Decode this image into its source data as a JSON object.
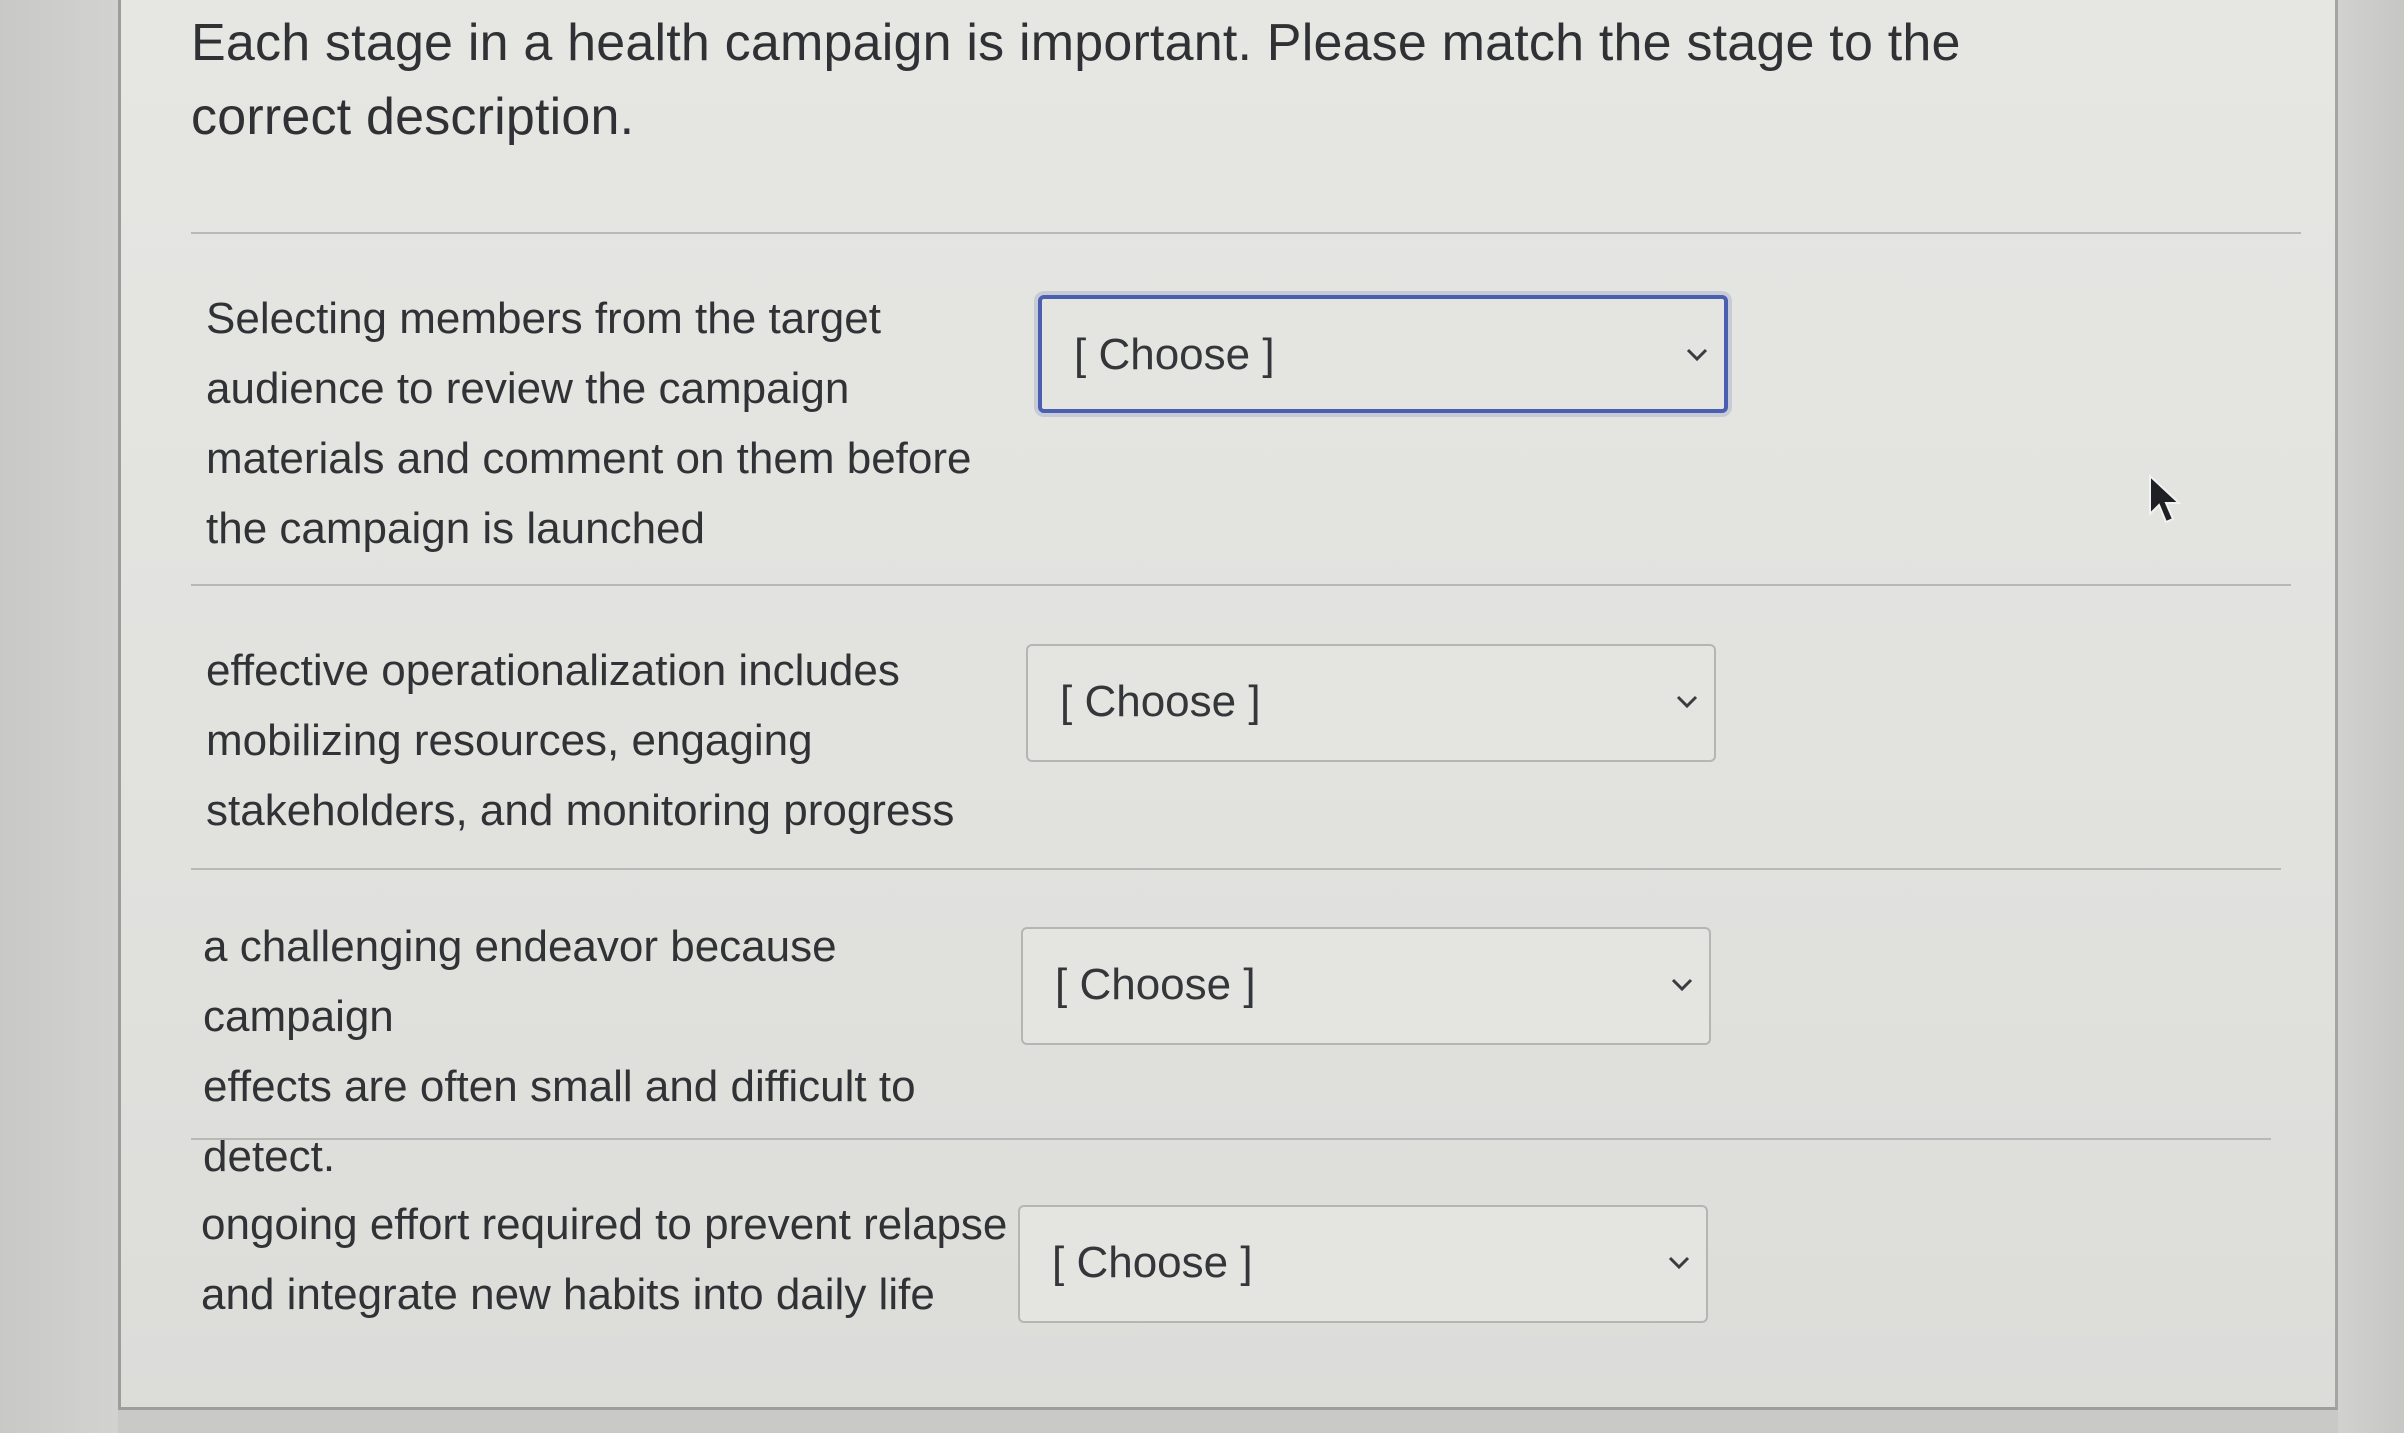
{
  "prompt": {
    "line1": "Each stage in a health campaign is important. Please match the stage to the",
    "line2": "correct description."
  },
  "rows": [
    {
      "description_lines": [
        "Selecting members from the target",
        "audience to review the campaign",
        "materials and comment on them before",
        "the campaign is launched"
      ],
      "select_value": "[ Choose ]",
      "focused": true
    },
    {
      "description_lines": [
        "effective operationalization includes",
        "mobilizing resources, engaging",
        "stakeholders, and monitoring progress"
      ],
      "select_value": "[ Choose ]",
      "focused": false
    },
    {
      "description_lines": [
        "a challenging endeavor because campaign",
        "effects are often small and difficult to",
        "detect."
      ],
      "select_value": "[ Choose ]",
      "focused": false
    },
    {
      "description_lines": [
        "ongoing effort required to prevent relapse",
        "and integrate new habits into daily life"
      ],
      "select_value": "[ Choose ]",
      "focused": false
    }
  ],
  "icons": {
    "dropdown": "chevron-down-icon",
    "pointer": "mouse-cursor-icon"
  },
  "colors": {
    "focus_ring": "#4a5fb0",
    "text": "#303235",
    "panel": "#e3e3e0"
  }
}
